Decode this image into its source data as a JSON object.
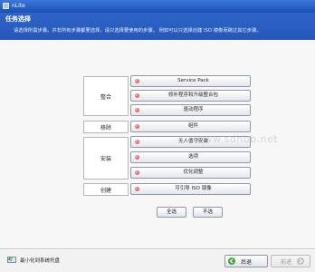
{
  "window": {
    "title": "nLite"
  },
  "header": {
    "title": "任务选择",
    "subtitle": "请选择所需步骤。并非所有步骤都要选择，请只选择要使用的步骤。 例如可以只选择创建 ISO 镜像而跳过其它步骤。"
  },
  "groups": {
    "integrate": "整合",
    "remove": "移除",
    "setup": "安装",
    "create": "创建"
  },
  "tasks": [
    {
      "label": "Service Pack"
    },
    {
      "label": "修补程序和升级整合包"
    },
    {
      "label": "驱动程序"
    },
    {
      "label": "组件"
    },
    {
      "label": "无人值守安装"
    },
    {
      "label": "选项"
    },
    {
      "label": "优化调整"
    },
    {
      "label": "可引导 ISO 镜像"
    }
  ],
  "actions": {
    "select_all": "全选",
    "select_none": "不选"
  },
  "footer": {
    "minimize_label": "最小化到系统托盘",
    "back_label": "后退",
    "next_label": "前进"
  },
  "watermark": "www.sdhbb.net",
  "colors": {
    "header_bg": "#2a5cbf",
    "indicator": "#d03030",
    "back_icon": "#3aaa3a"
  }
}
